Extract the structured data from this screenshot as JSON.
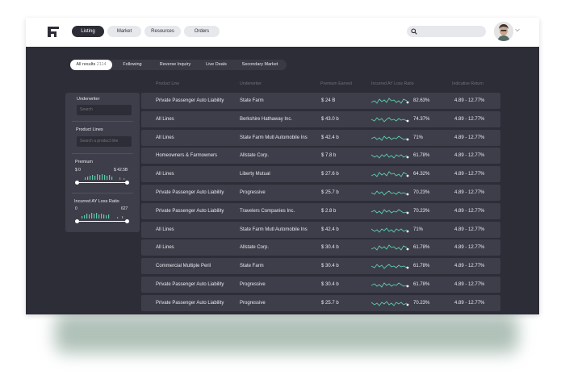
{
  "nav": {
    "tabs": [
      {
        "label": "Listing",
        "active": true
      },
      {
        "label": "Market",
        "active": false
      },
      {
        "label": "Resources",
        "active": false
      },
      {
        "label": "Orders",
        "active": false
      }
    ],
    "search_placeholder": ""
  },
  "chips": [
    {
      "label": "All results",
      "count": "2114",
      "active": true
    },
    {
      "label": "Following",
      "count": "",
      "active": false
    },
    {
      "label": "Reverse Inquiry",
      "count": "",
      "active": false
    },
    {
      "label": "Live Deals",
      "count": "",
      "active": false
    },
    {
      "label": "Secondary Market",
      "count": "",
      "active": false
    }
  ],
  "filters": {
    "underwriter_label": "Underwriter",
    "underwriter_placeholder": "Search",
    "product_lines_label": "Product Lines",
    "product_lines_placeholder": "Search a product line",
    "premium_label": "Premium",
    "premium_min": "$ 0",
    "premium_max": "$ 42.5B",
    "premium_sub_min": "0",
    "premium_sub_max": "",
    "loss_ratio_label": "Incurred AY Loss Ratio",
    "loss_ratio_min": "0",
    "loss_ratio_max": "627"
  },
  "table": {
    "columns": [
      "Product Line",
      "Underwriter",
      "Premium Earned",
      "Incurred AY Loss Ratio",
      "Indicative Return"
    ],
    "rows": [
      {
        "product": "Private Passenger Auto Liability",
        "underwriter": "State Farm",
        "premium": "$ 24 B",
        "loss_ratio": "82.63%",
        "return": "4.89 - 12.77%"
      },
      {
        "product": "All Lines",
        "underwriter": "Berkshire Hathaway Inc.",
        "premium": "$ 43.0 b",
        "loss_ratio": "74.37%",
        "return": "4.89 - 12.77%"
      },
      {
        "product": "All Lines",
        "underwriter": "State Farm Mutl Automobile Ins",
        "premium": "$ 42.4 b",
        "loss_ratio": "71%",
        "return": "4.89 - 12.77%"
      },
      {
        "product": "Homeowners & Farmowners",
        "underwriter": "Allstate Corp.",
        "premium": "$ 7.8 b",
        "loss_ratio": "61.78%",
        "return": "4.89 - 12.77%"
      },
      {
        "product": "All Lines",
        "underwriter": "Liberty Mutual",
        "premium": "$ 27.6 b",
        "loss_ratio": "64.32%",
        "return": "4.89 - 12.77%"
      },
      {
        "product": "Private Passenger Auto Liability",
        "underwriter": "Progressive",
        "premium": "$ 25.7 b",
        "loss_ratio": "70.23%",
        "return": "4.89 - 12.77%"
      },
      {
        "product": "Private Passenger Auto Liability",
        "underwriter": "Travelers Companies Inc.",
        "premium": "$ 2.8 b",
        "loss_ratio": "70.23%",
        "return": "4.89 - 12.77%"
      },
      {
        "product": "All Lines",
        "underwriter": "State Farm Mutl Automobile Ins",
        "premium": "$ 42.4 b",
        "loss_ratio": "71%",
        "return": "4.89 - 12.77%"
      },
      {
        "product": "All Lines",
        "underwriter": "Allstate Corp.",
        "premium": "$ 30.4 b",
        "loss_ratio": "61.78%",
        "return": "4.89 - 12.77%"
      },
      {
        "product": "Commercial Multiple Peril",
        "underwriter": "State Farm",
        "premium": "$ 30.4 b",
        "loss_ratio": "61.78%",
        "return": "4.89 - 12.77%"
      },
      {
        "product": "Private Passenger Auto Liability",
        "underwriter": "Progressive",
        "premium": "$ 30.4 b",
        "loss_ratio": "61.78%",
        "return": "4.89 - 12.77%"
      },
      {
        "product": "Private Passenger Auto Liability",
        "underwriter": "Progressive",
        "premium": "$ 25.7 b",
        "loss_ratio": "70.23%",
        "return": "4.89 - 12.77%"
      }
    ]
  },
  "colors": {
    "app_bg": "#2c2d36",
    "row_bg": "#3d3e49",
    "accent_green": "#5fc9a8",
    "text": "#e8e9ee",
    "muted": "#6e707b"
  }
}
